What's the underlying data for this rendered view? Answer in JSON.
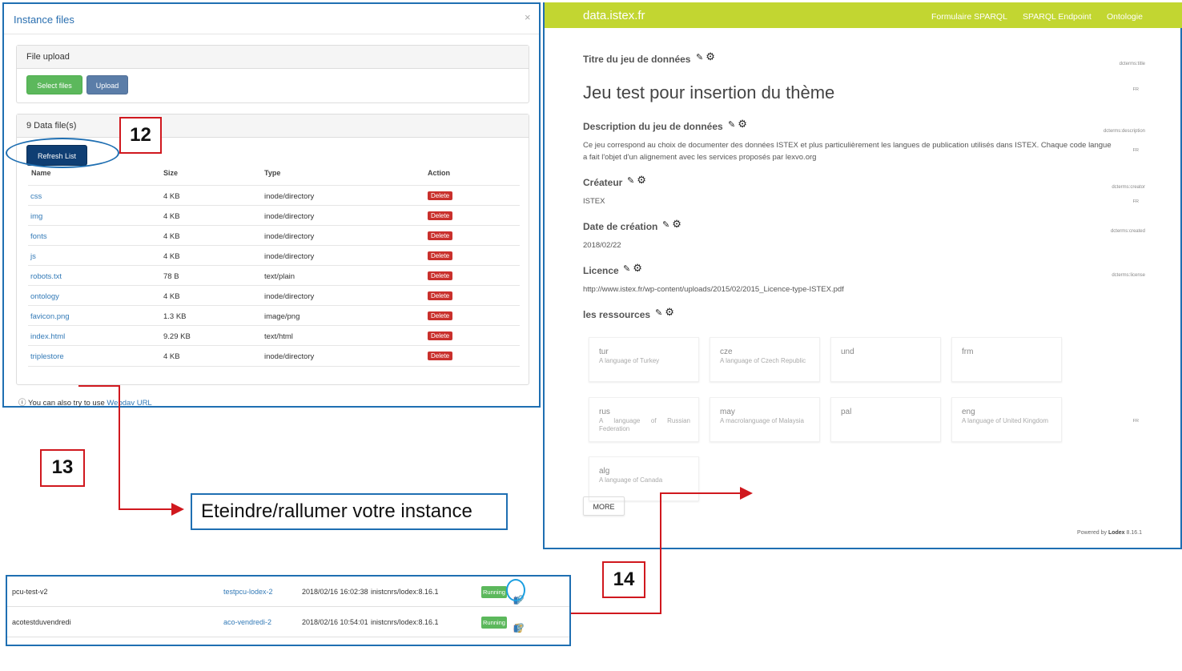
{
  "modal": {
    "title": "Instance files",
    "close": "×",
    "upload_panel": {
      "title": "File upload",
      "select_label": "Select files",
      "upload_label": "Upload"
    },
    "files_panel": {
      "title": "9 Data file(s)",
      "refresh_label": "Refresh List",
      "columns": [
        "Name",
        "Size",
        "Type",
        "Action"
      ],
      "rows": [
        {
          "name": "css",
          "size": "4 KB",
          "type": "inode/directory",
          "action": "Delete"
        },
        {
          "name": "img",
          "size": "4 KB",
          "type": "inode/directory",
          "action": "Delete"
        },
        {
          "name": "fonts",
          "size": "4 KB",
          "type": "inode/directory",
          "action": "Delete"
        },
        {
          "name": "js",
          "size": "4 KB",
          "type": "inode/directory",
          "action": "Delete"
        },
        {
          "name": "robots.txt",
          "size": "78 B",
          "type": "text/plain",
          "action": "Delete"
        },
        {
          "name": "ontology",
          "size": "4 KB",
          "type": "inode/directory",
          "action": "Delete"
        },
        {
          "name": "favicon.png",
          "size": "1.3 KB",
          "type": "image/png",
          "action": "Delete"
        },
        {
          "name": "index.html",
          "size": "9.29 KB",
          "type": "text/html",
          "action": "Delete"
        },
        {
          "name": "triplestore",
          "size": "4 KB",
          "type": "inode/directory",
          "action": "Delete"
        }
      ]
    },
    "webdav": {
      "icon": "info-icon",
      "text": "You can also try to use ",
      "link": "Webdav URL"
    }
  },
  "site": {
    "brand": "data.istex.fr",
    "accent": "#c2d631",
    "nav": [
      "Formulaire SPARQL",
      "SPARQL Endpoint",
      "Ontologie"
    ],
    "fields": {
      "title_label": "Titre du jeu de données",
      "title_vocab": "dcterms:title",
      "title_value": "Jeu test pour insertion du thème",
      "title_lang": "FR",
      "desc_label": "Description du jeu de données",
      "desc_vocab": "dcterms:description",
      "desc_value_1": "Ce jeu correspond au choix de documenter des données ISTEX et plus particulièrement les langues de publication utilisés dans ISTEX. Chaque code langue",
      "desc_value_2": "a fait l'objet d'un alignement avec les services proposés par lexvo.org",
      "desc_lang": "FR",
      "creator_label": "Créateur",
      "creator_vocab": "dcterms:creator",
      "creator_value": "ISTEX",
      "creator_lang": "FR",
      "date_label": "Date de création",
      "date_vocab": "dcterms:created",
      "date_value": "2018/02/22",
      "licence_label": "Licence",
      "licence_vocab": "dcterms:license",
      "licence_value": "http://www.istex.fr/wp-content/uploads/2015/02/2015_Licence-type-ISTEX.pdf",
      "res_label": "les ressources",
      "res_lang": "FR"
    },
    "resources": [
      {
        "code": "tur",
        "desc": "A language of Turkey"
      },
      {
        "code": "cze",
        "desc": "A language of Czech Republic"
      },
      {
        "code": "und",
        "desc": ""
      },
      {
        "code": "frm",
        "desc": ""
      },
      {
        "code": "rus",
        "desc": "A language of Russian Federation"
      },
      {
        "code": "may",
        "desc": "A macrolanguage of Malaysia"
      },
      {
        "code": "pal",
        "desc": ""
      },
      {
        "code": "eng",
        "desc": "A language of United Kingdom"
      },
      {
        "code": "alg",
        "desc": "A language of Canada"
      }
    ],
    "more_label": "MORE",
    "powered_prefix": "Powered by ",
    "powered_name": "Lodex",
    "powered_version": " 8.16.1"
  },
  "callouts": {
    "n12": "12",
    "n13": "13",
    "n14": "14",
    "text": "Eteindre/rallumer votre instance"
  },
  "instances": [
    {
      "name": "pcu-test-v2",
      "host": "testpcu-lodex-2",
      "date": "2018/02/16 16:02:38",
      "image": "inistcnrs/lodex:8.16.1",
      "status": "Running"
    },
    {
      "name": "acotestduvendredi",
      "host": "aco-vendredi-2",
      "date": "2018/02/16 10:54:01",
      "image": "inistcnrs/lodex:8.16.1",
      "status": "Running"
    }
  ]
}
